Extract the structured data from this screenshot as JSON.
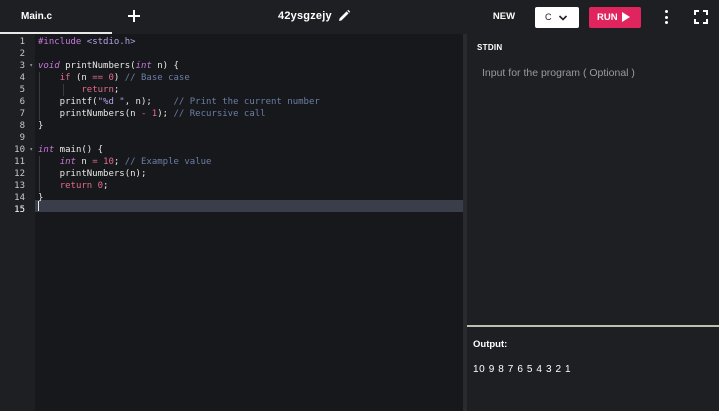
{
  "tabs": [
    {
      "label": "Main.c"
    }
  ],
  "project": {
    "name": "42ysgzejy"
  },
  "toolbar": {
    "new_label": "NEW",
    "language": "C",
    "run_label": "RUN"
  },
  "editor": {
    "line_numbers": [
      "1",
      "2",
      "3",
      "4",
      "5",
      "6",
      "7",
      "8",
      "9",
      "10",
      "11",
      "12",
      "13",
      "14",
      "15"
    ],
    "fold_markers": {
      "3": "▾",
      "10": "▾"
    },
    "active_line": 15
  },
  "stdin": {
    "label": "STDIN",
    "placeholder": "Input for the program ( Optional )"
  },
  "output": {
    "label": "Output:",
    "text": "10 9 8 7 6 5 4 3 2 1"
  },
  "colors": {
    "accent": "#e0245e",
    "background": "#17181b",
    "panel": "#1e1f22"
  },
  "icons": [
    "add-tab-icon",
    "pencil-icon",
    "chevron-down-icon",
    "play-icon",
    "more-vertical-icon",
    "fullscreen-icon"
  ]
}
